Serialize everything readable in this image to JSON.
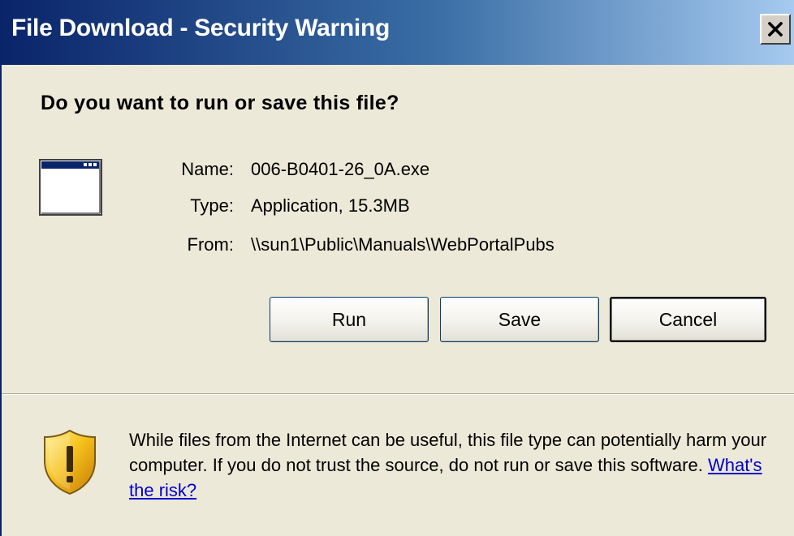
{
  "window": {
    "title": "File Download - Security Warning",
    "close_label": "×"
  },
  "dialog": {
    "question": "Do you want to run or save this file?"
  },
  "file": {
    "icon": "application-window-icon",
    "name_label": "Name:",
    "name_value": "006-B0401-26_0A.exe",
    "type_label": "Type:",
    "type_value": "Application, 15.3MB",
    "from_label": "From:",
    "from_value": "\\\\sun1\\Public\\Manuals\\WebPortalPubs"
  },
  "buttons": {
    "run": "Run",
    "save": "Save",
    "cancel": "Cancel"
  },
  "warning": {
    "icon": "security-shield-icon",
    "text": "While files from the Internet can be useful, this file type can potentially harm your computer. If you do not trust the source, do not run or save this software.",
    "link": "What's the risk?"
  },
  "colors": {
    "titlebar_start": "#0a246a",
    "titlebar_end": "#a6caf0",
    "dialog_bg": "#ece9d8",
    "link": "#0000cc"
  }
}
